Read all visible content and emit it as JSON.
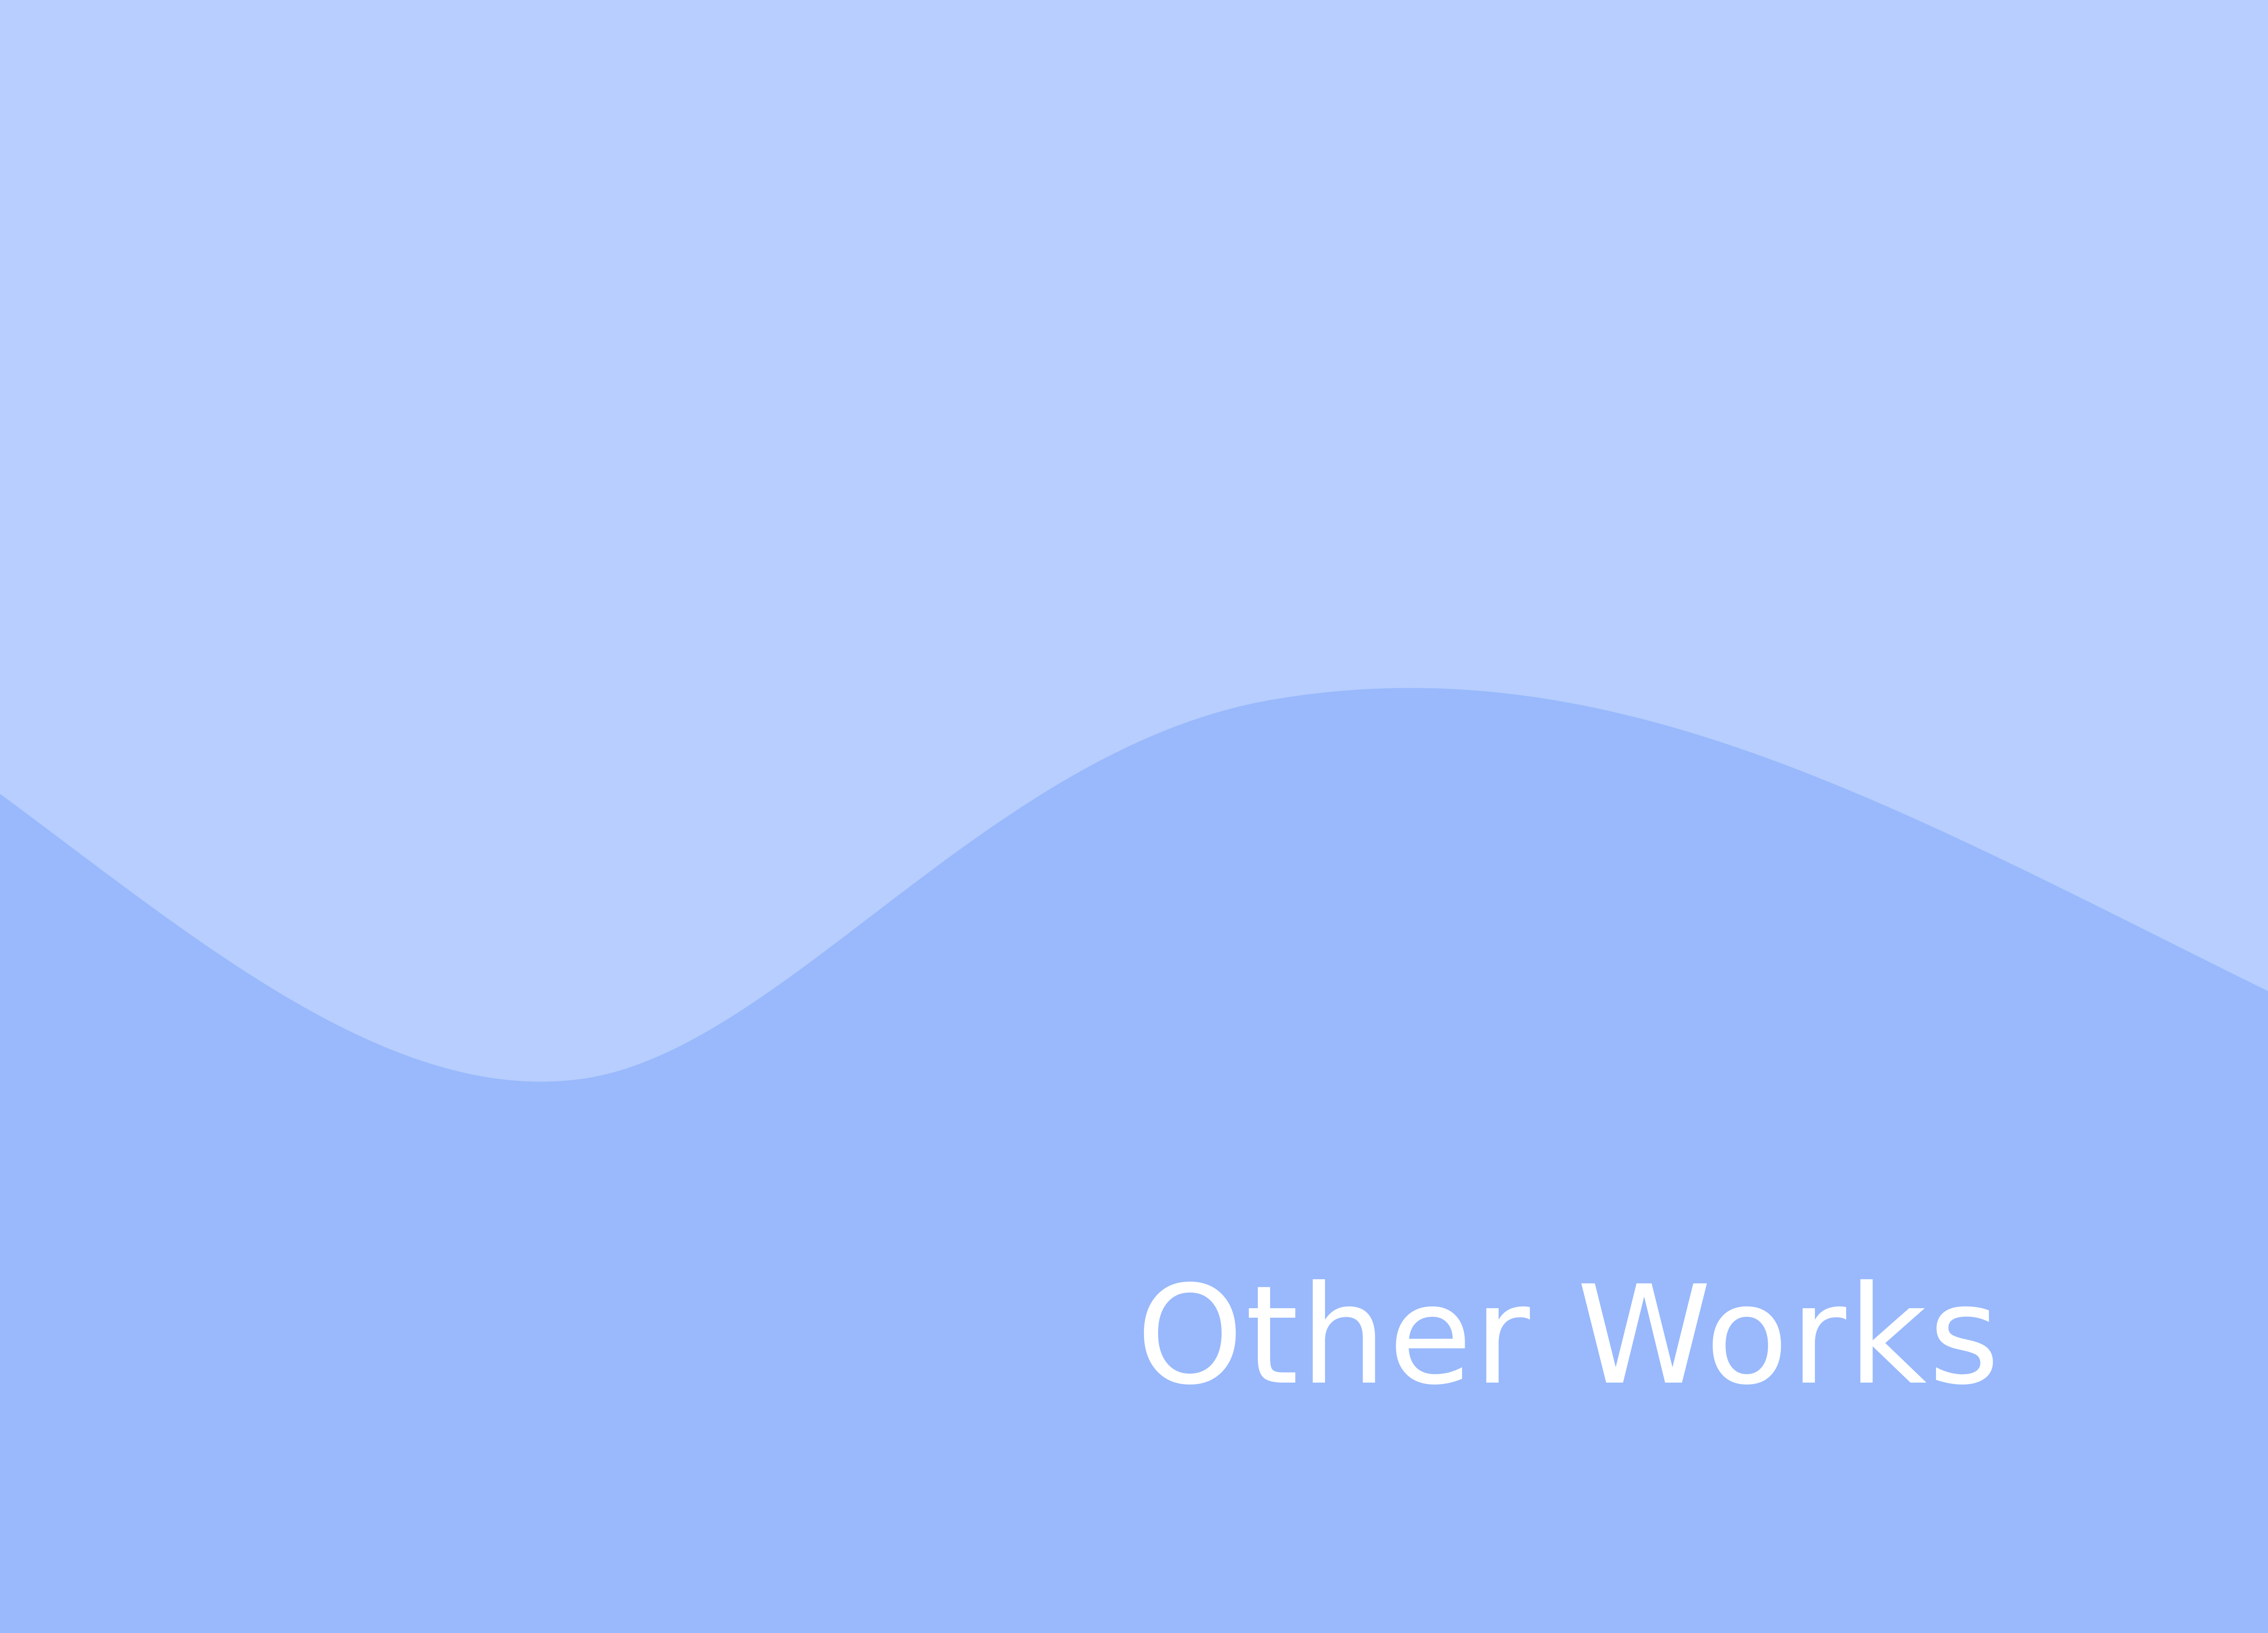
{
  "page": {
    "title": "Other Works"
  },
  "colors": {
    "upper_background": "#b7cefe",
    "lower_wave": "#99b9fc",
    "title_text": "#ffffff"
  }
}
